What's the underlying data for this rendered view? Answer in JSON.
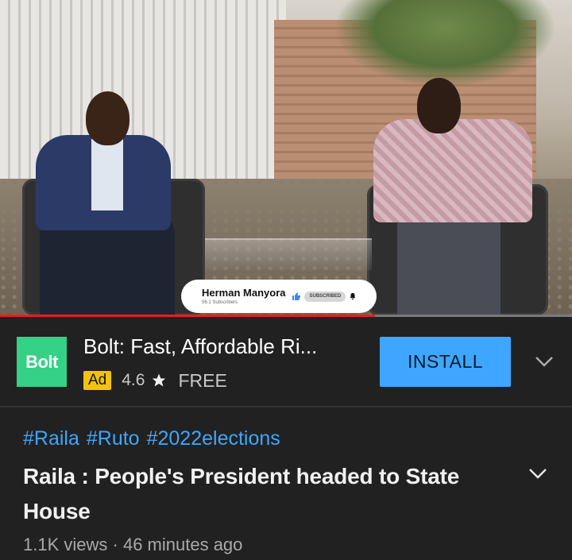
{
  "video": {
    "progress_fraction": 0.655,
    "channel_overlay": {
      "name": "Herman Manyora",
      "subscribers": "56.1 Subscribers",
      "subscribed_label": "SUBSCRIBED"
    }
  },
  "ad": {
    "logo_text": "Bolt",
    "logo_color": "#34d186",
    "title": "Bolt: Fast, Affordable Ri...",
    "badge": "Ad",
    "rating": "4.6",
    "price": "FREE",
    "install_label": "INSTALL",
    "install_color": "#3ea6ff"
  },
  "details": {
    "hashtags": [
      "#Raila",
      "#Ruto",
      "#2022elections"
    ],
    "title": "Raila : People's President headed to State House",
    "views": "1.1K views",
    "separator": "·",
    "time_ago": "46 minutes ago"
  },
  "icons": {
    "ad_expand": "chevron-down-icon",
    "title_expand": "chevron-down-icon",
    "rating": "star-icon",
    "like": "thumbs-up-icon",
    "notification": "bell-icon"
  },
  "colors": {
    "background": "#212121",
    "progress": "#e62117",
    "hashtag": "#3ea6ff",
    "ad_badge": "#f4c20d"
  }
}
